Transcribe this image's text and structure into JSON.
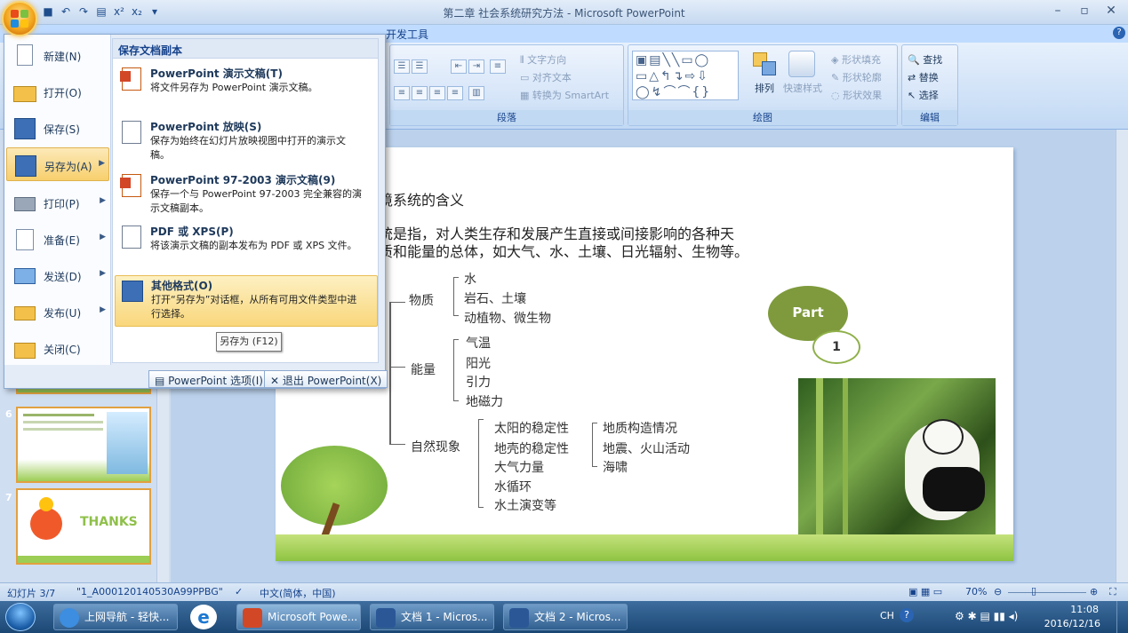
{
  "window": {
    "title": "第二章 社会系统研究方法 - Microsoft PowerPoint",
    "controls": [
      "–",
      "▫",
      "✕"
    ]
  },
  "ribbon": {
    "tab_visible": "开发工具",
    "help": "?",
    "paragraph": {
      "label": "段落",
      "text_direction": "文字方向",
      "align_text": "对齐文本",
      "smartart": "转换为 SmartArt"
    },
    "drawing": {
      "label": "绘图",
      "arrange": "排列",
      "quick_styles": "快速样式",
      "shape_fill": "形状填充",
      "shape_outline": "形状轮廓",
      "shape_effects": "形状效果"
    },
    "editing": {
      "label": "编辑",
      "find": "查找",
      "replace": "替换",
      "select": "选择"
    }
  },
  "office_menu": {
    "items": [
      {
        "label": "新建(N)",
        "icon": "new-doc-icon"
      },
      {
        "label": "打开(O)",
        "icon": "folder-open-icon"
      },
      {
        "label": "保存(S)",
        "icon": "save-icon"
      },
      {
        "label": "另存为(A)",
        "icon": "save-as-icon",
        "selected": true
      },
      {
        "label": "打印(P)",
        "icon": "printer-icon"
      },
      {
        "label": "准备(E)",
        "icon": "prepare-icon"
      },
      {
        "label": "发送(D)",
        "icon": "send-icon"
      },
      {
        "label": "发布(U)",
        "icon": "publish-icon"
      },
      {
        "label": "关闭(C)",
        "icon": "close-folder-icon"
      }
    ],
    "submenu": {
      "header": "保存文档副本",
      "options": [
        {
          "title": "PowerPoint 演示文稿(T)",
          "desc": "将文件另存为 PowerPoint 演示文稿。"
        },
        {
          "title": "PowerPoint 放映(S)",
          "desc": "保存为始终在幻灯片放映视图中打开的演示文稿。"
        },
        {
          "title": "PowerPoint 97-2003 演示文稿(9)",
          "desc": "保存一个与 PowerPoint 97-2003 完全兼容的演示文稿副本。"
        },
        {
          "title": "PDF 或 XPS(P)",
          "desc": "将该演示文稿的副本发布为 PDF 或 XPS 文件。"
        },
        {
          "title": "其他格式(O)",
          "desc": "打开“另存为”对话框，从所有可用文件类型中进行选择。"
        }
      ],
      "tooltip": "另存为 (F12)"
    },
    "footer": {
      "options_btn": "PowerPoint 选项(I)",
      "exit_btn": "退出 PowerPoint(X)"
    }
  },
  "slide_panel": {
    "thumbs": [
      {
        "num": "6"
      },
      {
        "num": "7",
        "text": "THANKS"
      }
    ]
  },
  "slide": {
    "heading": "境系统的含义",
    "para1": "统是指，对人类生存和发展产生直接或间接影响的各种天",
    "para2": "质和能量的总体，如大气、水、土壤、日光辐射、生物等。",
    "tree": {
      "matter": "物质",
      "matter_items": [
        "水",
        "岩石、土壤",
        "动植物、微生物"
      ],
      "energy": "能量",
      "energy_items": [
        "气温",
        "阳光",
        "引力",
        "地磁力"
      ],
      "natural": "自然现象",
      "natural_items": [
        "太阳的稳定性",
        "地壳的稳定性",
        "大气力量",
        "水循环",
        "水土演变等"
      ],
      "crust_items": [
        "地质构造情况",
        "地震、火山活动",
        "海啸"
      ]
    },
    "part_label": "Part",
    "part_num": "1"
  },
  "statusbar": {
    "slide_info": "幻灯片 3/7",
    "theme": "\"1_A000120140530A99PPBG\"",
    "language": "中文(简体，中国)",
    "zoom": "70%"
  },
  "taskbar": {
    "items": [
      {
        "label": "上网导航 - 轻快..."
      },
      {
        "label": "Microsoft Powe..."
      },
      {
        "label": "文档 1 - Micros..."
      },
      {
        "label": "文档 2 - Micros..."
      }
    ],
    "ime": "CH",
    "time": "11:08",
    "date": "2016/12/16"
  },
  "colors": {
    "accent": "#f7cf6d",
    "part_bubble": "#7e9a3c"
  }
}
